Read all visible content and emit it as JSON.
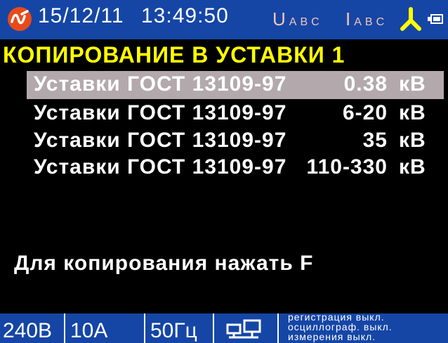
{
  "header": {
    "date": "15/12/11",
    "time": "13:49:50",
    "voltage_indicator": {
      "main": "U",
      "phases": "ABC"
    },
    "current_indicator": {
      "main": "I",
      "phases": "ABC"
    },
    "icons": [
      "logo-icon",
      "phase-star-icon",
      "battery-icon"
    ]
  },
  "title": "КОПИРОВАНИЕ В УСТАВКИ 1",
  "menu": {
    "items": [
      {
        "name": "Уставки ГОСТ 13109-97",
        "value": "0.38",
        "unit": "кВ",
        "selected": true
      },
      {
        "name": "Уставки ГОСТ 13109-97",
        "value": "6-20",
        "unit": "кВ",
        "selected": false
      },
      {
        "name": "Уставки ГОСТ 13109-97",
        "value": "35",
        "unit": "кВ",
        "selected": false
      },
      {
        "name": "Уставки ГОСТ 13109-97",
        "value": "110-330",
        "unit": "кВ",
        "selected": false
      }
    ]
  },
  "hint": "Для копирования нажать F",
  "statusbar": {
    "voltage": "240В",
    "current": "10А",
    "frequency": "50Гц",
    "status_lines": [
      "регистрация выкл.",
      "осциллограф. выкл.",
      "измерения выкл."
    ]
  },
  "colors": {
    "bar_background": "#1546a6",
    "title": "#ffff00",
    "selection": "#b3a9ac",
    "indicator_inactive": "#f3c6b3",
    "logo": "#e84b1a",
    "phase_star": "#ffff00"
  }
}
